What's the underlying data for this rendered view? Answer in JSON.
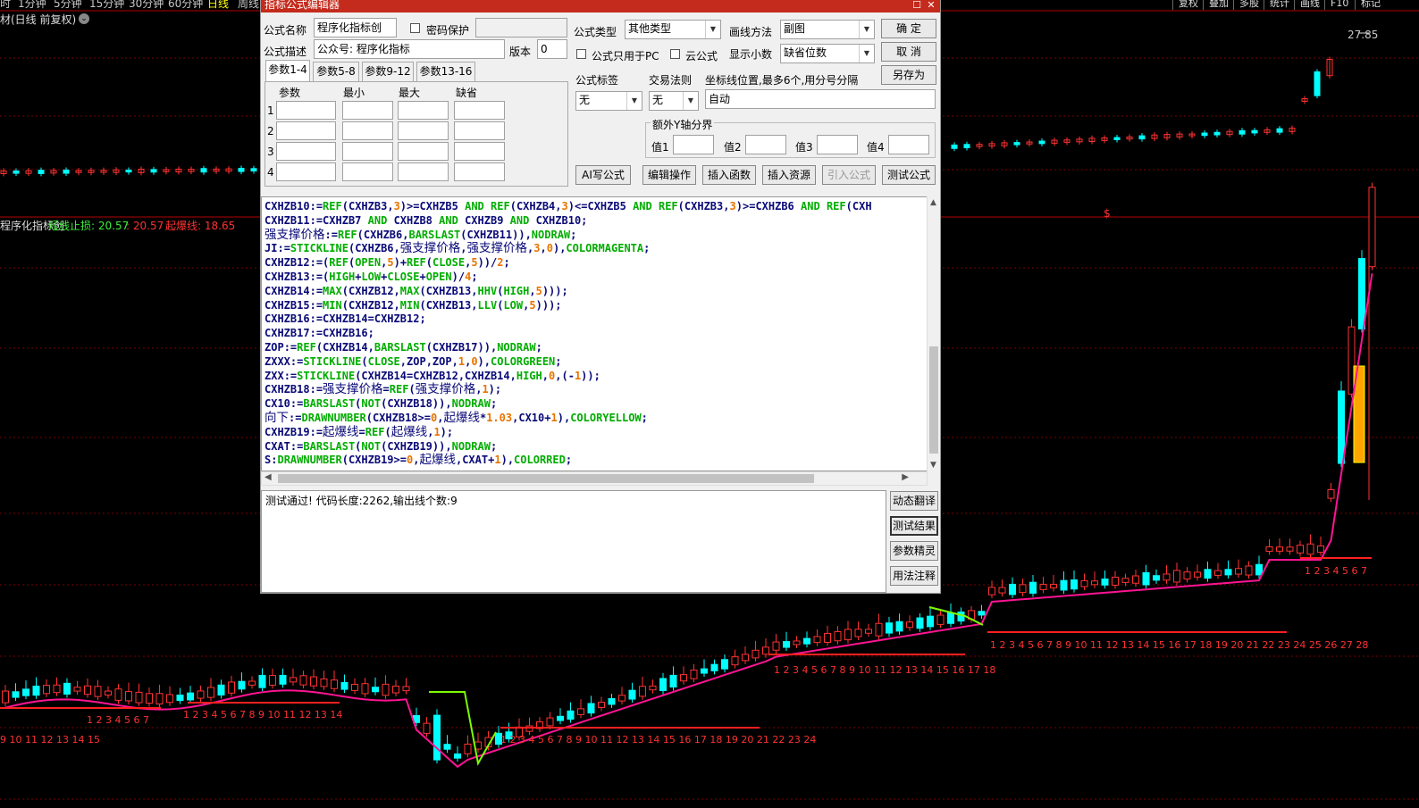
{
  "topbar": {
    "periods": [
      "时",
      "1分钟",
      "5分钟",
      "15分钟",
      "30分钟",
      "60分钟",
      "日线",
      "周线"
    ],
    "active_period": "日线",
    "right_buttons": [
      "复权",
      "叠加",
      "多股",
      "统计",
      "画线",
      "F10",
      "标记"
    ]
  },
  "chart": {
    "title": "材(日线 前复权)",
    "max_price_label": "27.85",
    "dollar_mark": "$",
    "indicator_name": "程序化指标创",
    "ind_label1": "短线止损: 20.57",
    "ind_sep": ": 20.57",
    "ind_label2": "起爆线: 18.65",
    "counter_row_left": "9 10 11 12 13 14 15",
    "counters": [
      {
        "text": "1 2 3 4 5 6 7"
      },
      {
        "text": "1 2 3 4 5 6 7 8 9 10 11 12 13 14"
      },
      {
        "text": "1 2 3 4 5 6 7 8 9 10 11 12 13 14 15 16 17 18 19 20 21 22 23 24"
      },
      {
        "text": "1 2 3 4 5 6 7 8 9 10 11 12 13 14 15 16 17 18"
      },
      {
        "text": "1 2 3 4 5 6 7 8 9 10 11 12 13 14 15 16 17 18 19 20 21 22 23 24 25 26 27 28"
      },
      {
        "text": "1 2 3 4 5 6 7"
      }
    ],
    "colors": {
      "up": "#ff3232",
      "down": "#00ffff",
      "ma": "#ff1493",
      "line_green": "#7cfc00",
      "grid": "#7a0000"
    }
  },
  "dialog": {
    "title": "指标公式编辑器",
    "name_label": "公式名称",
    "name_value": "程序化指标创",
    "pwd_label": "密码保护",
    "desc_label": "公式描述",
    "desc_value": "公众号: 程序化指标",
    "version_label": "版本",
    "version_value": "0",
    "type_label": "公式类型",
    "type_value": "其他类型",
    "draw_label": "画线方法",
    "draw_value": "副图",
    "pc_only_label": "公式只用于PC",
    "cloud_label": "云公式",
    "decimals_label": "显示小数",
    "decimals_value": "缺省位数",
    "ok": "确 定",
    "cancel": "取 消",
    "saveas": "另存为",
    "tabs": [
      "参数1-4",
      "参数5-8",
      "参数9-12",
      "参数13-16"
    ],
    "param_headers": [
      "参数",
      "最小",
      "最大",
      "缺省"
    ],
    "param_rows": [
      "1",
      "2",
      "3",
      "4"
    ],
    "tag_label": "公式标签",
    "tag_value": "无",
    "trade_label": "交易法则",
    "trade_value": "无",
    "coord_label": "坐标线位置,最多6个,用分号分隔",
    "coord_value": "自动",
    "yaxis_label": "额外Y轴分界",
    "y_values": [
      "值1",
      "值2",
      "值3",
      "值4"
    ],
    "buttons": [
      "AI写公式",
      "编辑操作",
      "插入函数",
      "插入资源",
      "引入公式",
      "测试公式"
    ],
    "result_text": "测试通过! 代码长度:2262,输出线个数:9",
    "side_buttons": [
      "动态翻译",
      "测试结果",
      "参数精灵",
      "用法注释"
    ],
    "code_lines": [
      "CXHZB10:=REF(CXHZB3,3)>=CXHZB5 AND REF(CXHZB4,3)<=CXHZB5 AND REF(CXHZB3,3)>=CXHZB6 AND REF(CXH",
      "CXHZB11:=CXHZB7 AND CXHZB8 AND CXHZB9 AND CXHZB10;",
      "强支撑价格:=REF(CXHZB6,BARSLAST(CXHZB11)),NODRAW;",
      "JI:=STICKLINE(CXHZB6,强支撑价格,强支撑价格,3,0),COLORMAGENTA;",
      "CXHZB12:=(REF(OPEN,5)+REF(CLOSE,5))/2;",
      "CXHZB13:=(HIGH+LOW+CLOSE+OPEN)/4;",
      "CXHZB14:=MAX(CXHZB12,MAX(CXHZB13,HHV(HIGH,5)));",
      "CXHZB15:=MIN(CXHZB12,MIN(CXHZB13,LLV(LOW,5)));",
      "CXHZB16:=CXHZB14=CXHZB12;",
      "CXHZB17:=CXHZB16;",
      "ZOP:=REF(CXHZB14,BARSLAST(CXHZB17)),NODRAW;",
      "ZXXX:=STICKLINE(CLOSE,ZOP,ZOP,1,0),COLORGREEN;",
      "ZXX:=STICKLINE(CXHZB14=CXHZB12,CXHZB14,HIGH,0,(-1));",
      "CXHZB18:=强支撑价格=REF(强支撑价格,1);",
      "CX10:=BARSLAST(NOT(CXHZB18)),NODRAW;",
      "向下:=DRAWNUMBER(CXHZB18>=0,起爆线*1.03,CX10+1),COLORYELLOW;",
      "CXHZB19:=起爆线=REF(起爆线,1);",
      "CXAT:=BARSLAST(NOT(CXHZB19)),NODRAW;",
      "S:DRAWNUMBER(CXHZB19>=0,起爆线,CXAT+1),COLORRED;"
    ]
  }
}
